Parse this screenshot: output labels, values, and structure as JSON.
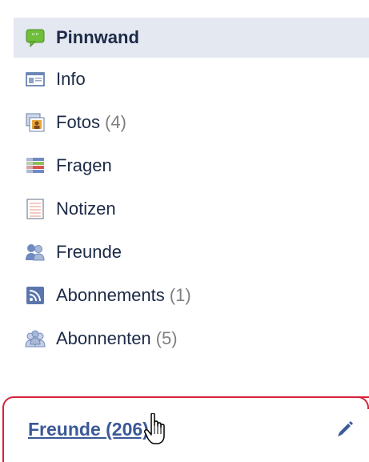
{
  "sidebar": {
    "items": [
      {
        "label": "Pinnwand",
        "count": "",
        "icon": "wall-speech-bubble-icon"
      },
      {
        "label": "Info",
        "count": "",
        "icon": "info-card-icon"
      },
      {
        "label": "Fotos",
        "count": "(4)",
        "icon": "photos-icon"
      },
      {
        "label": "Fragen",
        "count": "",
        "icon": "questions-icon"
      },
      {
        "label": "Notizen",
        "count": "",
        "icon": "notes-icon"
      },
      {
        "label": "Freunde",
        "count": "",
        "icon": "friends-icon"
      },
      {
        "label": "Abonnements",
        "count": "(1)",
        "icon": "rss-feed-icon"
      },
      {
        "label": "Abonnenten",
        "count": "(5)",
        "icon": "subscribers-icon"
      }
    ]
  },
  "friends_section": {
    "link_label": "Freunde (206)",
    "edit_icon": "pencil-icon"
  },
  "colors": {
    "active_bg": "#e4e8f1",
    "link": "#3b5998",
    "highlight_border": "#d6213a",
    "count_gray": "#808080"
  }
}
